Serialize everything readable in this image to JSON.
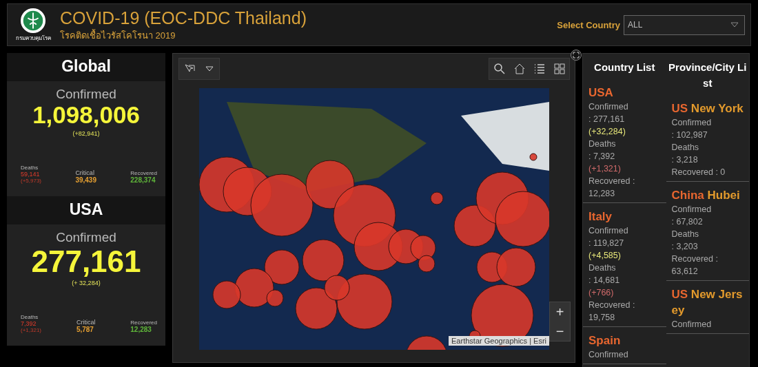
{
  "header": {
    "title": "COVID-19 (EOC-DDC Thailand)",
    "subtitle": "โรคติดเชื้อไวรัสโคโรนา 2019",
    "logo_caption": "กรมควบคุมโรค",
    "select_label": "Select Country",
    "select_value": "ALL"
  },
  "summaries": [
    {
      "title": "Global",
      "confirmed_label": "Confirmed",
      "confirmed": "1,098,006",
      "confirmed_delta": "(+82,941)",
      "deaths_label": "Deaths",
      "deaths": "59,141",
      "deaths_delta": "(+5,973)",
      "critical_label": "Critical",
      "critical": "39,439",
      "recovered_label": "Recovered",
      "recovered": "228,374"
    },
    {
      "title": "USA",
      "confirmed_label": "Confirmed",
      "confirmed": "277,161",
      "confirmed_delta": "(+ 32,284)",
      "deaths_label": "Deaths",
      "deaths": "7,392",
      "deaths_delta": "(+1,321)",
      "critical_label": "Critical",
      "critical": "5,787",
      "recovered_label": "Recovered",
      "recovered": "12,283"
    }
  ],
  "map": {
    "attribution": "Earthstar Geographics | Esri",
    "zoom_in": "+",
    "zoom_out": "−"
  },
  "country_list": {
    "title": "Country List",
    "items": [
      {
        "name": "USA",
        "confirmed_label": "Confirmed",
        "confirmed": ": 277,161",
        "confirmed_delta": "(+32,284)",
        "deaths_label": "Deaths",
        "deaths": ": 7,392",
        "deaths_delta": "(+1,321)",
        "recovered_label": "Recovered :",
        "recovered": "12,283"
      },
      {
        "name": "Italy",
        "confirmed_label": "Confirmed",
        "confirmed": ": 119,827",
        "confirmed_delta": "(+4,585)",
        "deaths_label": "Deaths",
        "deaths": ": 14,681",
        "deaths_delta": "(+766)",
        "recovered_label": "Recovered :",
        "recovered": "19,758"
      },
      {
        "name": "Spain",
        "confirmed_label": "Confirmed"
      }
    ]
  },
  "province_list": {
    "title": "Province/City List",
    "items": [
      {
        "country": "US",
        "region": "New York",
        "confirmed_label": "Confirmed",
        "confirmed": ": 102,987",
        "deaths_label": "Deaths",
        "deaths": ": 3,218",
        "recovered_label": "Recovered : 0"
      },
      {
        "country": "China",
        "region": "Hubei",
        "confirmed_label": "Confirmed",
        "confirmed": ": 67,802",
        "deaths_label": "Deaths",
        "deaths": ": 3,203",
        "recovered_label": "Recovered :",
        "recovered": "63,612"
      },
      {
        "country": "US",
        "region": "New Jersey",
        "confirmed_label": "Confirmed"
      }
    ]
  }
}
